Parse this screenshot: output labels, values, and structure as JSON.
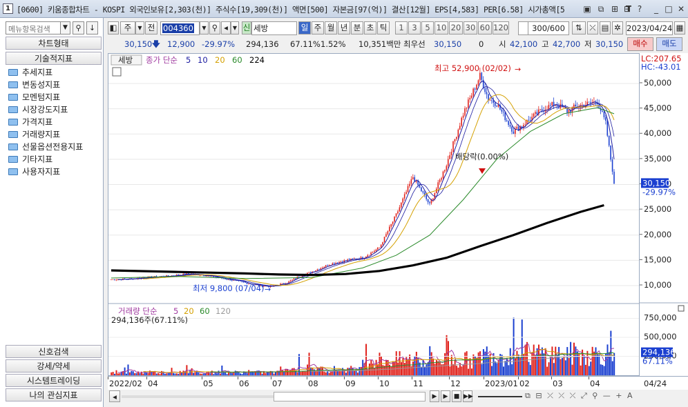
{
  "window": {
    "number": "1",
    "title": "[0600] 키움종합차트 - KOSPI 외국인보유[2,303(천)] 주식수[19,309(천)] 액면[500] 자본금[97(억)] 결산[12월] EPS[4,583] PER[6.58] 시가총액[5",
    "title_buttons": [
      "▣",
      "⧉",
      "⊞",
      "⊟",
      "T",
      "?",
      "_",
      "□",
      "✕"
    ]
  },
  "left_panel": {
    "search_placeholder": "메뉴항목검색",
    "chart_type_label": "차트형태",
    "tech_label": "기술적지표",
    "folders": [
      "추세지표",
      "변동성지표",
      "모멘텀지표",
      "시장강도지표",
      "가격지표",
      "거래량지표",
      "선물옵션전용지표",
      "기타지표",
      "사용자지표"
    ],
    "bottom_buttons": [
      "신호검색",
      "강세/약세",
      "시스템트레이딩",
      "나의 관심지표"
    ]
  },
  "toolbar": {
    "period_main": "주",
    "prev_label": "전",
    "code": "004360",
    "stock_badge": "신",
    "stock_name": "세방",
    "periods": [
      "일",
      "주",
      "월",
      "년",
      "분",
      "초",
      "틱"
    ],
    "active_period": "일",
    "intervals": [
      "1",
      "3",
      "5",
      "10",
      "20",
      "30",
      "60",
      "120"
    ],
    "count": "300/600",
    "date": "2023/04/24"
  },
  "quote": {
    "price": "30,150",
    "change": "12,900",
    "change_pct": "-29.97%",
    "volume": "294,136",
    "volume_ratio": "67.11%",
    "turnover_pct": "1.52%",
    "amount": "10,351백만",
    "pref_label": "최우선",
    "best_price": "30,150",
    "best_qty": "0",
    "open_label": "시",
    "open": "42,100",
    "high_label": "고",
    "high": "42,700",
    "low_label": "저",
    "low": "30,150",
    "buy_label": "매수",
    "sell_label": "매도"
  },
  "price_panel": {
    "legend_stock": "세방",
    "legend_ma_label": "종가 단순",
    "ma_periods": [
      "5",
      "10",
      "20",
      "60",
      "224"
    ],
    "ma_colors": [
      "#1a1aa0",
      "#1a1aa0",
      "#d4a000",
      "#2a8a2a",
      "#000000"
    ],
    "lc": "LC:207.65",
    "hc": "HC:-43.01",
    "max_annotation": "최고 52,900 (02/02)",
    "min_annotation": "최저 9,800 (07/04)",
    "dividend_annotation": "배당락(0.00%)",
    "current_price_tag": "30,150",
    "current_pct_tag": "-29.97%"
  },
  "volume_panel": {
    "legend_label": "거래량 단순",
    "ma_periods": [
      "5",
      "20",
      "60",
      "120"
    ],
    "ma_colors": [
      "#a03aa0",
      "#d4a000",
      "#2a8a2a",
      "#9a9a9a"
    ],
    "value_label": "294,136주(67.11%)",
    "volume_tag": "294,136",
    "volume_pct_tag": "67.11%"
  },
  "x_axis": {
    "labels": [
      "2022/02",
      "04",
      "05",
      "06",
      "07",
      "08",
      "09",
      "10",
      "11",
      "12",
      "2023/01",
      "02",
      "03",
      "04"
    ],
    "right_label": "04/24"
  },
  "chart_data": [
    {
      "type": "line",
      "title": "",
      "y_ticks": [
        10000,
        15000,
        20000,
        25000,
        30000,
        35000,
        40000,
        45000,
        50000
      ],
      "y_tick_labels": [
        "10,000",
        "15,000",
        "20,000",
        "25,000",
        "30,000",
        "35,000",
        "40,000",
        "45,000",
        "50,000"
      ],
      "ylim": [
        7000,
        54500
      ],
      "series": [
        {
          "name": "세방",
          "x": [
            0,
            10,
            20,
            35,
            45,
            55,
            65,
            75,
            85,
            95,
            105,
            112,
            120,
            130,
            140,
            150,
            160,
            170,
            180,
            190,
            200,
            210,
            220,
            225,
            230,
            240,
            250,
            258,
            265,
            272,
            278,
            285,
            290,
            295,
            300
          ],
          "values": [
            11200,
            11300,
            11600,
            11900,
            12300,
            12100,
            11500,
            10900,
            10200,
            9800,
            10600,
            11800,
            12800,
            14200,
            15000,
            15500,
            17500,
            24000,
            31500,
            26000,
            34000,
            44000,
            51500,
            47000,
            46000,
            40500,
            43000,
            45000,
            46000,
            44500,
            45500,
            46000,
            46500,
            42100,
            30150
          ]
        },
        {
          "name": "60",
          "x": [
            0,
            40,
            80,
            120,
            150,
            170,
            190,
            210,
            230,
            250,
            270,
            290,
            300
          ],
          "values": [
            11500,
            11800,
            11400,
            11600,
            13500,
            16000,
            20000,
            27000,
            35000,
            40500,
            44000,
            45200,
            44000
          ]
        },
        {
          "name": "224",
          "x": [
            0,
            40,
            80,
            100,
            120,
            140,
            160,
            180,
            200,
            220,
            240,
            260,
            280,
            294
          ],
          "values": [
            13000,
            12700,
            12400,
            12200,
            12100,
            12300,
            12900,
            14000,
            15500,
            17800,
            20000,
            22400,
            24600,
            25900
          ]
        }
      ]
    },
    {
      "type": "bar",
      "title": "",
      "y_ticks": [
        250000,
        500000,
        750000
      ],
      "y_tick_labels": [
        "250,000",
        "500,000",
        "750,000"
      ],
      "ylim": [
        0,
        800000
      ],
      "last_volume": 294136
    }
  ]
}
